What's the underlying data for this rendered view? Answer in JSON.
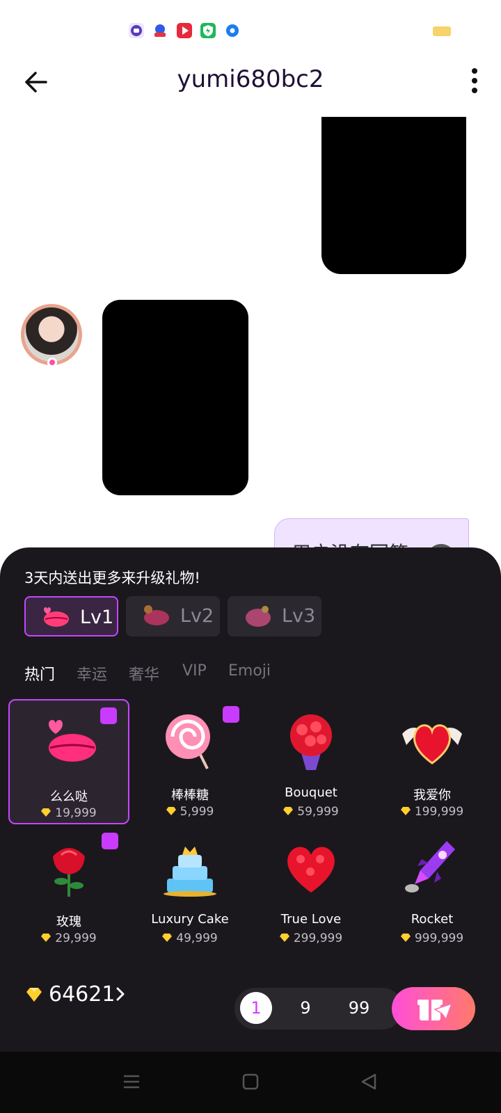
{
  "status_bar": {
    "icons": [
      "app-icon-purple",
      "baidu-icon",
      "video-icon",
      "shield-icon",
      "browser-icon"
    ],
    "battery_color": "#f6d36b"
  },
  "header": {
    "title": "yumi680bc2",
    "back_icon": "arrow-left-icon",
    "more_icon": "kebab-menu-icon"
  },
  "chat": {
    "partial_bubble_text": "用户没有回答"
  },
  "gift_panel": {
    "hint": "3天内送出更多来升级礼物!",
    "levels": [
      {
        "label": "Lv1",
        "active": true
      },
      {
        "label": "Lv2",
        "active": false
      },
      {
        "label": "Lv3",
        "active": false
      }
    ],
    "tabs": [
      {
        "label": "热门",
        "active": true
      },
      {
        "label": "幸运",
        "active": false
      },
      {
        "label": "奢华",
        "active": false
      },
      {
        "label": "VIP",
        "active": false
      },
      {
        "label": "Emoji",
        "active": false
      }
    ],
    "gifts": [
      {
        "name": "么么哒",
        "price": "19,999",
        "icon": "kiss-lips-icon",
        "selected": true,
        "hot": true
      },
      {
        "name": "棒棒糖",
        "price": "5,999",
        "icon": "lollipop-icon",
        "selected": false,
        "hot": true
      },
      {
        "name": "Bouquet",
        "price": "59,999",
        "icon": "bouquet-icon",
        "selected": false,
        "hot": false
      },
      {
        "name": "我爱你",
        "price": "199,999",
        "icon": "winged-heart-icon",
        "selected": false,
        "hot": false
      },
      {
        "name": "玫瑰",
        "price": "29,999",
        "icon": "rose-icon",
        "selected": false,
        "hot": true
      },
      {
        "name": "Luxury Cake",
        "price": "49,999",
        "icon": "cake-icon",
        "selected": false,
        "hot": false
      },
      {
        "name": "True Love",
        "price": "299,999",
        "icon": "rose-heart-icon",
        "selected": false,
        "hot": false
      },
      {
        "name": "Rocket",
        "price": "999,999",
        "icon": "rocket-icon",
        "selected": false,
        "hot": false
      }
    ],
    "balance": "64621",
    "quantities": [
      {
        "label": "1",
        "active": true
      },
      {
        "label": "9",
        "active": false
      },
      {
        "label": "99",
        "active": false
      }
    ],
    "accent_color": "#c347ff"
  },
  "nav_bar": {
    "buttons": [
      "menu-icon",
      "home-icon",
      "back-triangle-icon"
    ]
  }
}
